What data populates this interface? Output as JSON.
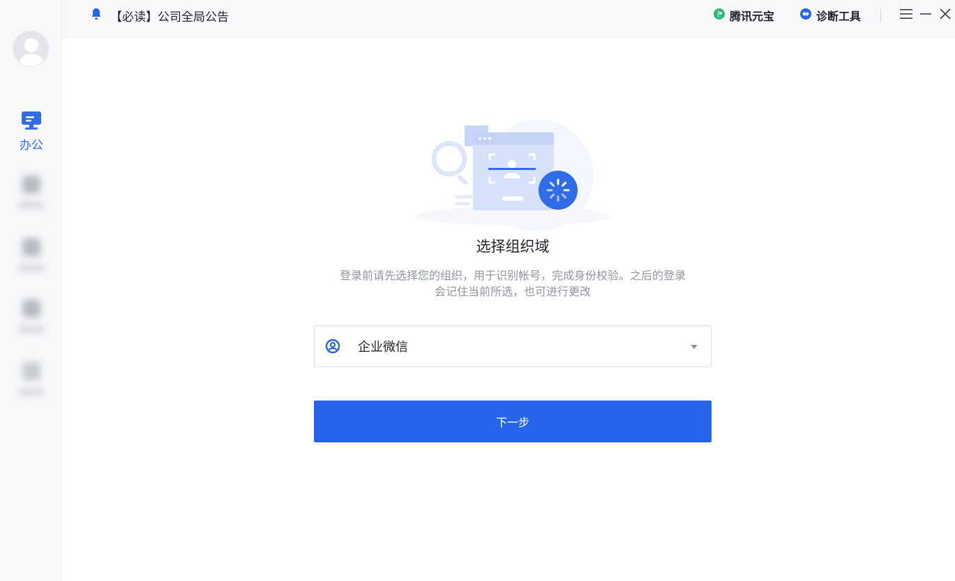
{
  "topbar": {
    "notice": "【必读】公司全局公告",
    "yuanbao": "腾讯元宝",
    "diagnostic": "诊断工具"
  },
  "sidebar": {
    "office_label": "办公"
  },
  "main": {
    "title": "选择组织域",
    "description_line1": "登录前请先选择您的组织，用于识别帐号，完成身份校验。之后的登录",
    "description_line2": "会记住当前所选，也可进行更改",
    "org_select": {
      "value": "企业微信"
    },
    "next_button": "下一步"
  },
  "colors": {
    "accent": "#2664ea",
    "sidebar_bg": "#f7f8fa",
    "muted_text": "#8f959e"
  },
  "icons": {
    "notice": "bell-icon",
    "yuanbao": "yuanbao-logo-icon",
    "diagnostic": "diagnostic-icon",
    "menu": "menu-icon",
    "minimize": "minimize-icon",
    "close": "close-icon",
    "office": "monitor-icon",
    "org": "org-user-icon"
  }
}
